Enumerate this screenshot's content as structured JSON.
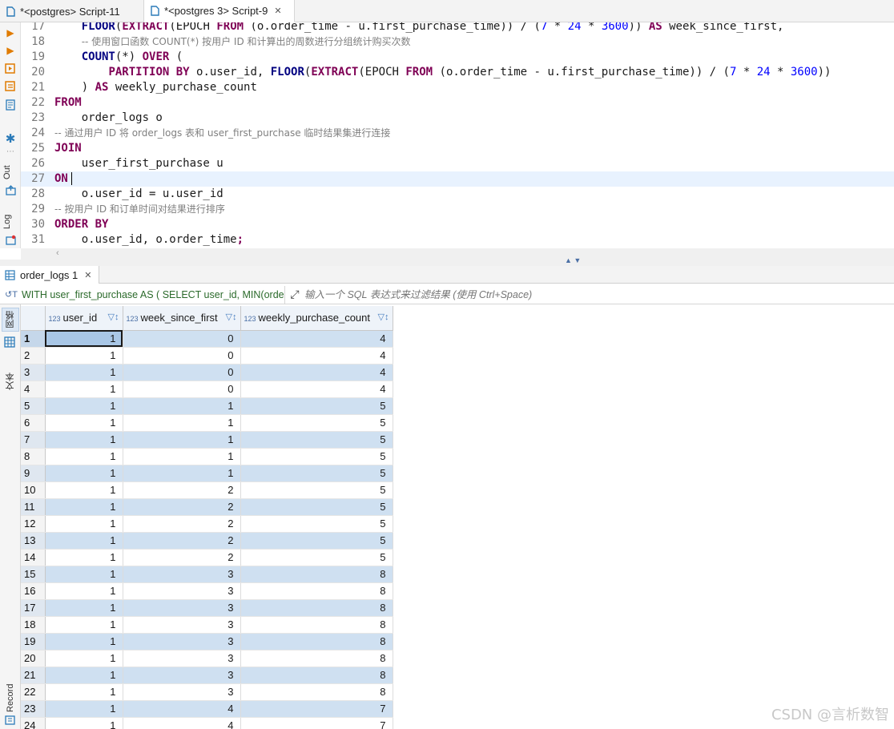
{
  "tabs": [
    {
      "label": "*<postgres> Script-11",
      "active": false
    },
    {
      "label": "*<postgres 3> Script-9",
      "active": true
    }
  ],
  "editor": {
    "left_toolbar": {
      "out_label": "Out",
      "log_label": "Log"
    },
    "lines": [
      {
        "n": "17",
        "tokens": [
          [
            "",
            "    "
          ],
          [
            "fn",
            "FLOOR"
          ],
          [
            "",
            "("
          ],
          [
            "kw",
            "EXTRACT"
          ],
          [
            "",
            "(EPOCH "
          ],
          [
            "kw",
            "FROM"
          ],
          [
            "",
            " (o.order_time - u.first_purchase_time)) / ("
          ],
          [
            "num",
            "7"
          ],
          [
            "",
            " * "
          ],
          [
            "num",
            "24"
          ],
          [
            "",
            " * "
          ],
          [
            "num",
            "3600"
          ],
          [
            "",
            ")) "
          ],
          [
            "kw",
            "AS"
          ],
          [
            "",
            " week_since_first,"
          ]
        ]
      },
      {
        "n": "18",
        "tokens": [
          [
            "",
            "    "
          ],
          [
            "cm",
            "-- 使用窗口函数 COUNT(*) 按用户 ID 和计算出的周数进行分组统计购买次数"
          ]
        ]
      },
      {
        "n": "19",
        "tokens": [
          [
            "",
            "    "
          ],
          [
            "fn",
            "COUNT"
          ],
          [
            "",
            "(*) "
          ],
          [
            "kw",
            "OVER"
          ],
          [
            "",
            " ("
          ]
        ]
      },
      {
        "n": "20",
        "tokens": [
          [
            "",
            "        "
          ],
          [
            "kw",
            "PARTITION BY"
          ],
          [
            "",
            " o.user_id, "
          ],
          [
            "fn",
            "FLOOR"
          ],
          [
            "",
            "("
          ],
          [
            "kw",
            "EXTRACT"
          ],
          [
            "",
            "(EPOCH "
          ],
          [
            "kw",
            "FROM"
          ],
          [
            "",
            " (o.order_time - u.first_purchase_time)) / ("
          ],
          [
            "num",
            "7"
          ],
          [
            "",
            " * "
          ],
          [
            "num",
            "24"
          ],
          [
            "",
            " * "
          ],
          [
            "num",
            "3600"
          ],
          [
            "",
            "))"
          ]
        ]
      },
      {
        "n": "21",
        "tokens": [
          [
            "",
            "    ) "
          ],
          [
            "kw",
            "AS"
          ],
          [
            "",
            " weekly_purchase_count"
          ]
        ]
      },
      {
        "n": "22",
        "tokens": [
          [
            "kw",
            "FROM"
          ]
        ]
      },
      {
        "n": "23",
        "tokens": [
          [
            "",
            "    order_logs o"
          ]
        ]
      },
      {
        "n": "24",
        "tokens": [
          [
            "cm",
            "-- 通过用户 ID 将 order_logs 表和 user_first_purchase 临时结果集进行连接"
          ]
        ]
      },
      {
        "n": "25",
        "tokens": [
          [
            "kw",
            "JOIN"
          ]
        ]
      },
      {
        "n": "26",
        "tokens": [
          [
            "",
            "    user_first_purchase u"
          ]
        ]
      },
      {
        "n": "27",
        "tokens": [
          [
            "kw",
            "ON"
          ]
        ],
        "current": true
      },
      {
        "n": "28",
        "tokens": [
          [
            "",
            "    o.user_id = u.user_id"
          ]
        ]
      },
      {
        "n": "29",
        "tokens": [
          [
            "cm",
            "-- 按用户 ID 和订单时间对结果进行排序"
          ]
        ]
      },
      {
        "n": "30",
        "tokens": [
          [
            "kw",
            "ORDER BY"
          ]
        ]
      },
      {
        "n": "31",
        "tokens": [
          [
            "",
            "    o.user_id, o.order_time"
          ],
          [
            "kw",
            ";"
          ]
        ]
      }
    ]
  },
  "results": {
    "tab_label": "order_logs 1",
    "query_preview": "WITH user_first_purchase AS ( SELECT user_id, MIN(orde",
    "filter_placeholder": "输入一个 SQL 表达式来过滤结果 (使用 Ctrl+Space)",
    "side_tabs": {
      "grid": "网格",
      "text": "文本",
      "record": "Record"
    },
    "type_badge": "123",
    "columns": [
      "user_id",
      "week_since_first",
      "weekly_purchase_count"
    ],
    "rows": [
      [
        "1",
        "1",
        "0",
        "4"
      ],
      [
        "2",
        "1",
        "0",
        "4"
      ],
      [
        "3",
        "1",
        "0",
        "4"
      ],
      [
        "4",
        "1",
        "0",
        "4"
      ],
      [
        "5",
        "1",
        "1",
        "5"
      ],
      [
        "6",
        "1",
        "1",
        "5"
      ],
      [
        "7",
        "1",
        "1",
        "5"
      ],
      [
        "8",
        "1",
        "1",
        "5"
      ],
      [
        "9",
        "1",
        "1",
        "5"
      ],
      [
        "10",
        "1",
        "2",
        "5"
      ],
      [
        "11",
        "1",
        "2",
        "5"
      ],
      [
        "12",
        "1",
        "2",
        "5"
      ],
      [
        "13",
        "1",
        "2",
        "5"
      ],
      [
        "14",
        "1",
        "2",
        "5"
      ],
      [
        "15",
        "1",
        "3",
        "8"
      ],
      [
        "16",
        "1",
        "3",
        "8"
      ],
      [
        "17",
        "1",
        "3",
        "8"
      ],
      [
        "18",
        "1",
        "3",
        "8"
      ],
      [
        "19",
        "1",
        "3",
        "8"
      ],
      [
        "20",
        "1",
        "3",
        "8"
      ],
      [
        "21",
        "1",
        "3",
        "8"
      ],
      [
        "22",
        "1",
        "3",
        "8"
      ],
      [
        "23",
        "1",
        "4",
        "7"
      ],
      [
        "24",
        "1",
        "4",
        "7"
      ]
    ]
  },
  "watermark": "CSDN @言析数智",
  "colors": {
    "keyword": "#7f0055",
    "function": "#000080",
    "number": "#0000ff",
    "comment": "#808080",
    "row_highlight": "#cfe0f1"
  }
}
